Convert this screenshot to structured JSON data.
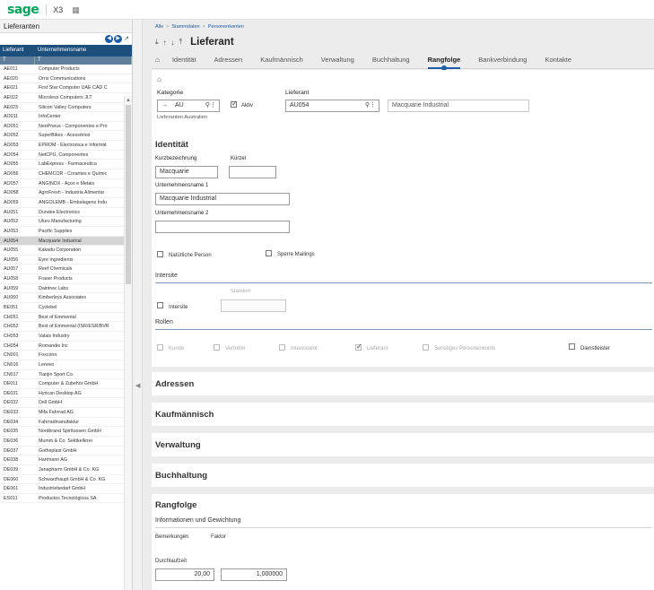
{
  "topbar": {
    "logo": "sage",
    "product": "X3",
    "calendar_icon": "calendar-icon"
  },
  "left_panel": {
    "title": "Lieferanten",
    "columns": [
      "Lieferant",
      "Unternehmensname"
    ],
    "filter_symbol": "T",
    "selected_code": "AU054",
    "rows": [
      [
        "AE011",
        "Computer Products"
      ],
      [
        "AE020",
        "Orris Communications"
      ],
      [
        "AE021",
        "First Star Computer UAE CAD C"
      ],
      [
        "AE022",
        "Microless Computers JLT"
      ],
      [
        "AE023",
        "Silicon Valley Computers"
      ],
      [
        "AO011",
        "InfoCenter"
      ],
      [
        "AO051",
        "NeoPneus - Componentes e Pro"
      ],
      [
        "AO052",
        "SuperBikes - Acessórios"
      ],
      [
        "AO053",
        "EPROM - Electronica e Informát"
      ],
      [
        "AO054",
        "NetCPU, Componentes"
      ],
      [
        "AO055",
        "LabExpress - Farmaceutica"
      ],
      [
        "AO056",
        "CHEMCOR - Corantes e Químic"
      ],
      [
        "AO057",
        "ANGINOX - Aços e Metais"
      ],
      [
        "AO058",
        "AgroFresh - Industria Alimentar"
      ],
      [
        "AO059",
        "ANGOLEMB - Embalagens Indu"
      ],
      [
        "AU051",
        "Dundee Electronics"
      ],
      [
        "AU052",
        "Uluru Manufacturing"
      ],
      [
        "AU053",
        "Pacific Supplies"
      ],
      [
        "AU054",
        "Macquarie Industrial"
      ],
      [
        "AU055",
        "Kakadu Corporation"
      ],
      [
        "AU056",
        "Eyre Ingredients"
      ],
      [
        "AU057",
        "Reef Chemicals"
      ],
      [
        "AU058",
        "Fraser Products"
      ],
      [
        "AU059",
        "Daintree Labs"
      ],
      [
        "AU060",
        "Kimberleys Associates"
      ],
      [
        "BE051",
        "Cyclebel"
      ],
      [
        "CH051",
        "Best of Emmental"
      ],
      [
        "CH052",
        "Best of Emmental (ISR/ESR/BVR"
      ],
      [
        "CH053",
        "Valais Industry"
      ],
      [
        "CH054",
        "Romandie Inc"
      ],
      [
        "CN001",
        "Foxconn"
      ],
      [
        "CN016",
        "Lenovo"
      ],
      [
        "CN017",
        "Tianjin Sport Co."
      ],
      [
        "DE011",
        "Computer & Zubehör GmbH"
      ],
      [
        "DE031",
        "Hyrican Desktop AG"
      ],
      [
        "DE032",
        "Dell GmbH"
      ],
      [
        "DE033",
        "Mifa Fahrrad AG"
      ],
      [
        "DE034",
        "Fahrradmanufaktur"
      ],
      [
        "DE035",
        "Nordbrand Spirituosen GmbH"
      ],
      [
        "DE036",
        "Mumm & Co. Sektkellerei"
      ],
      [
        "DE037",
        "Gotheplast GmbH"
      ],
      [
        "DE038",
        "Hartmann AG"
      ],
      [
        "DE039",
        "Janapharm GmbH & Co. KG"
      ],
      [
        "DE060",
        "Schwarzhaupt GmbH & Co. KG"
      ],
      [
        "DE061",
        "Industriebedarf GmbH"
      ],
      [
        "ES011",
        "Productos Tecnológicos SA"
      ]
    ]
  },
  "main": {
    "breadcrumb": [
      "Alle",
      "Stammdaten",
      "Personenkonten"
    ],
    "breadcrumb_sep": ">",
    "page_title": "Lieferant",
    "tabs": [
      "Identität",
      "Adressen",
      "Kaufmännisch",
      "Verwaltung",
      "Buchhaltung",
      "Rangfolge",
      "Bankverbindung",
      "Kontakte"
    ],
    "active_tab": "Rangfolge",
    "header": {
      "kategorie_label": "Kategorie",
      "kategorie_value": "AU",
      "kategorie_arrow": "→",
      "kategorie_hint": "Lieferanten Australien",
      "aktiv_label": "Aktiv",
      "aktiv_checked": true,
      "lieferant_label": "Lieferant",
      "lieferant_value": "AU054",
      "lieferant_name": "Macquarie Industrial"
    },
    "identitaet": {
      "title": "Identität",
      "kurzbezeichnung_label": "Kurzbezeichnung",
      "kurzbezeichnung_value": "Macquarie",
      "kuerzel_label": "Kürzel",
      "kuerzel_value": "",
      "name1_label": "Unternehmensname 1",
      "name1_value": "Macquarie Industrial",
      "name2_label": "Unternehmensname 2",
      "name2_value": "",
      "natuerliche_person_label": "Natürliche Person",
      "sperre_mailings_label": "Sperre Mailings",
      "intersite_header": "Intersite",
      "intersite_label": "Intersite",
      "standort_label": "Standort",
      "rollen_header": "Rollen",
      "roles": [
        {
          "label": "Kunde",
          "checked": false,
          "disabled": true
        },
        {
          "label": "Vertreter",
          "checked": false,
          "disabled": true
        },
        {
          "label": "Interessent",
          "checked": false,
          "disabled": true
        },
        {
          "label": "Lieferant",
          "checked": true,
          "disabled": true
        },
        {
          "label": "Sonstiges Personenkonto",
          "checked": false,
          "disabled": true
        },
        {
          "label": "Dienstleister",
          "checked": false,
          "disabled": false
        }
      ]
    },
    "sections": [
      "Adressen",
      "Kaufmännisch",
      "Verwaltung",
      "Buchhaltung"
    ],
    "rangfolge": {
      "title": "Rangfolge",
      "sub": "Informationen und Gewichtung",
      "col1": "Bemerkungen",
      "col2": "Faktor",
      "durchlaufzeit_label": "Durchlaufzeit",
      "durchlaufzeit_value": "20,00",
      "faktor_value": "1,000000"
    }
  }
}
